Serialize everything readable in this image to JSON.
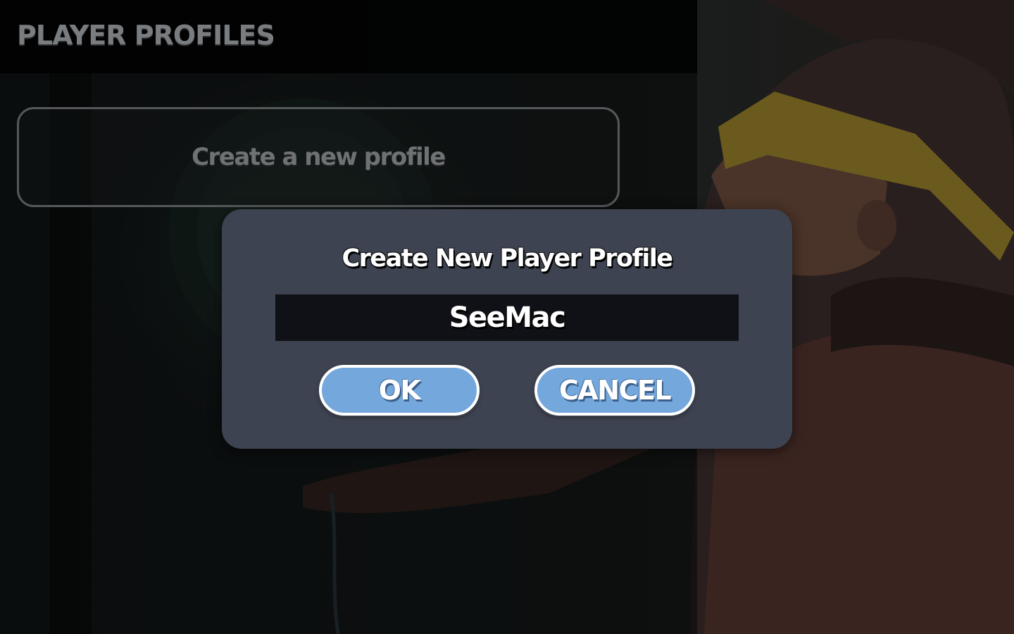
{
  "screen": {
    "title": "PLAYER PROFILES"
  },
  "menu": {
    "create_profile_label": "Create a new profile"
  },
  "dialog": {
    "title": "Create New Player Profile",
    "name_value": "SeeMac",
    "ok_label": "OK",
    "cancel_label": "CANCEL"
  },
  "colors": {
    "dialog_bg": "#3d4350",
    "button_fill": "#74a7dc",
    "field_bg": "#101116"
  }
}
